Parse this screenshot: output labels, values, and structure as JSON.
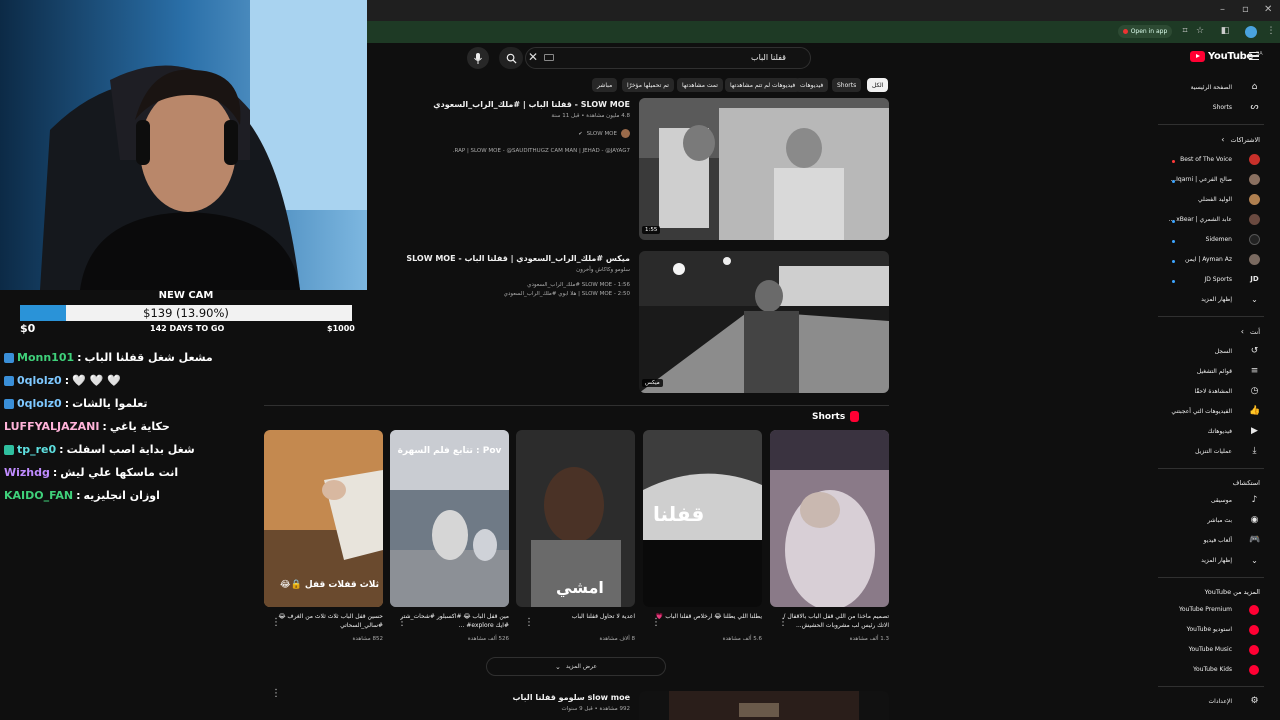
{
  "browser": {
    "open_in_app": "Open in app"
  },
  "search": {
    "query": "قفلنا الباب"
  },
  "youtube": {
    "logo_text": "YouTube",
    "region": "SA"
  },
  "chips": [
    "الكل",
    "Shorts",
    "فيديوهات",
    "فيديوهات لم تتم مشاهدتها",
    "تمت مشاهدتها",
    "تم تحميلها مؤخرًا",
    "مباشر"
  ],
  "results": [
    {
      "title": "SLOW MOE - قفلنا الباب | #ملك_الراب_السعودي",
      "meta": "4.8 مليون مشاهدة • قبل 11 سنة",
      "channel": "SLOW MOE",
      "desc": "RAP | SLOW MOE - @SAUDITHUGZ CAM MAN | JEHAD - @JAYAG7.",
      "duration": "1:55"
    },
    {
      "title": "ميكس #ملك_الراب_السعودي | قفلنا الباب - SLOW MOE",
      "sub": "سلومو وكاكاش وآخرون",
      "line1": "SLOW MOE - 1:56 #ملك_الراب_السعودي",
      "line2": "SLOW MOE - 2:50 | هلا ابوي #ملك_الراب_السعودي",
      "duration": "ميكس"
    }
  ],
  "shorts_section": {
    "label": "Shorts",
    "show_more": "عرض المزيد"
  },
  "shorts": [
    {
      "title": "تصميم ماخذا من اللي قفل الباب بالاقفال /الاتك رئيس لب مشروبات الحشيش...",
      "views": "1.3 ألف مشاهدة",
      "overlay": ""
    },
    {
      "title": "يطلنا اللي يطلنا 😂 ارخلاص قفلنا الباب 💗",
      "views": "5.6 ألف مشاهدة",
      "overlay": "قفلنا"
    },
    {
      "title": "اعدية لا تحاول قفلنا الباب",
      "views": "8 آلاف مشاهدة",
      "overlay": "امشي"
    },
    {
      "title": "مين قفل الباب 😂 #اكسبلور #شحات_شتر #ايك explore# ...",
      "views": "526 ألف مشاهدة",
      "overlay": "Pov : تتابع فلم السهرة"
    },
    {
      "title": "حسين قفل الباب ثلاث ثلاث من الغرف 😂 #سالي_السحاتي",
      "views": "852 مشاهدة",
      "overlay": "ثلاث قفلات قفل 🔒😂"
    }
  ],
  "bottom_result": {
    "title": "slow moe سلومو قفلنا الباب",
    "meta": "992 مشاهدة • قبل 9 سنوات"
  },
  "sidebar": {
    "home": "الصفحة الرئيسية",
    "shorts": "Shorts",
    "subs_header": "الاشتراكات",
    "subs": [
      "Best of The Voice",
      "صالح الفرعي | Iqarni...",
      "الوليد الفضلي",
      "عابد الشمري | xBear ...",
      "Sidemen",
      "Ayman Az | ايمن",
      "JD Sports"
    ],
    "show_more": "إظهار المزيد",
    "you_header": "أنت",
    "you": [
      "السجل",
      "قوائم التشغيل",
      "المشاهدة لاحقًا",
      "الفيديوهات التي أعجبتني",
      "فيديوهاتك",
      "عمليات التنزيل"
    ],
    "explore_header": "استكشاف",
    "explore": [
      "موسيقى",
      "بث مباشر",
      "ألعاب فيديو",
      "إظهار المزيد"
    ],
    "more_header": "المزيد من YouTube",
    "more": [
      "YouTube Premium",
      "استوديو YouTube",
      "YouTube Music",
      "YouTube Kids"
    ],
    "settings": "الإعدادات"
  },
  "stream": {
    "goal_title": "NEW CAM",
    "goal_amount": "$139 (13.90%)",
    "goal_fraction": 0.139,
    "goal_min": "$0",
    "goal_days": "142 DAYS TO GO",
    "goal_max": "$1000"
  },
  "chat": [
    {
      "user": "Monn101",
      "msg": "مشعل شغل قفلنا الباب",
      "color": "#3fd07a"
    },
    {
      "user": "0qlolz0",
      "msg": "🤍 🤍 🤍",
      "color": "#7ec8ff"
    },
    {
      "user": "0qlolz0",
      "msg": "تعلموا يالشات",
      "color": "#7ec8ff"
    },
    {
      "user": "LUFFYALJAZANI",
      "msg": "حكاية ياغي",
      "color": "#ffb3d9"
    },
    {
      "user": "tp_re0",
      "msg": "شغل بداية اصب اسفلت",
      "color": "#5ee0e0"
    },
    {
      "user": "Wizhdg",
      "msg": "انت ماسكها علي ليش",
      "color": "#c08cff"
    },
    {
      "user": "KAIDO_FAN",
      "msg": "اوزان انجليزيه",
      "color": "#3fd07a"
    }
  ]
}
